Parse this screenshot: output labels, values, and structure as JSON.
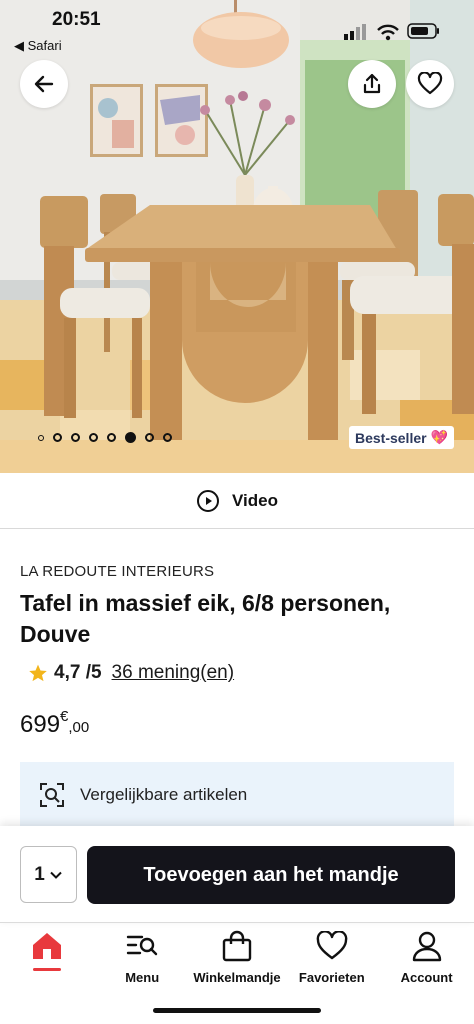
{
  "status_bar": {
    "time": "20:51",
    "back_app": "Safari"
  },
  "gallery": {
    "dot_count": 8,
    "active_dot": 6,
    "badge_text": "Best-seller",
    "badge_emoji": "💖"
  },
  "video": {
    "label": "Video"
  },
  "product": {
    "brand": "LA REDOUTE INTERIEURS",
    "title": "Tafel in massief eik, 6/8 personen, Douve",
    "rating_value": "4,7 /5",
    "reviews_label": "36 mening(en)",
    "price_main": "699",
    "price_currency": "€",
    "price_cents": ",00"
  },
  "similar": {
    "label": "Vergelijkbare artikelen"
  },
  "cart_bar": {
    "quantity": "1",
    "add_button_label": "Toevoegen aan het mandje"
  },
  "bottom_nav": {
    "items": [
      {
        "label": "",
        "icon": "home-icon"
      },
      {
        "label": "Menu",
        "icon": "menu-search-icon"
      },
      {
        "label": "Winkelmandje",
        "icon": "shopping-bag-icon"
      },
      {
        "label": "Favorieten",
        "icon": "heart-icon"
      },
      {
        "label": "Account",
        "icon": "user-icon"
      }
    ]
  },
  "colors": {
    "accent": "#e8393d",
    "button_dark": "#14141b",
    "similar_bg": "#eaf3fb",
    "badge_text": "#2d3a5e",
    "star": "#f2b51c"
  }
}
